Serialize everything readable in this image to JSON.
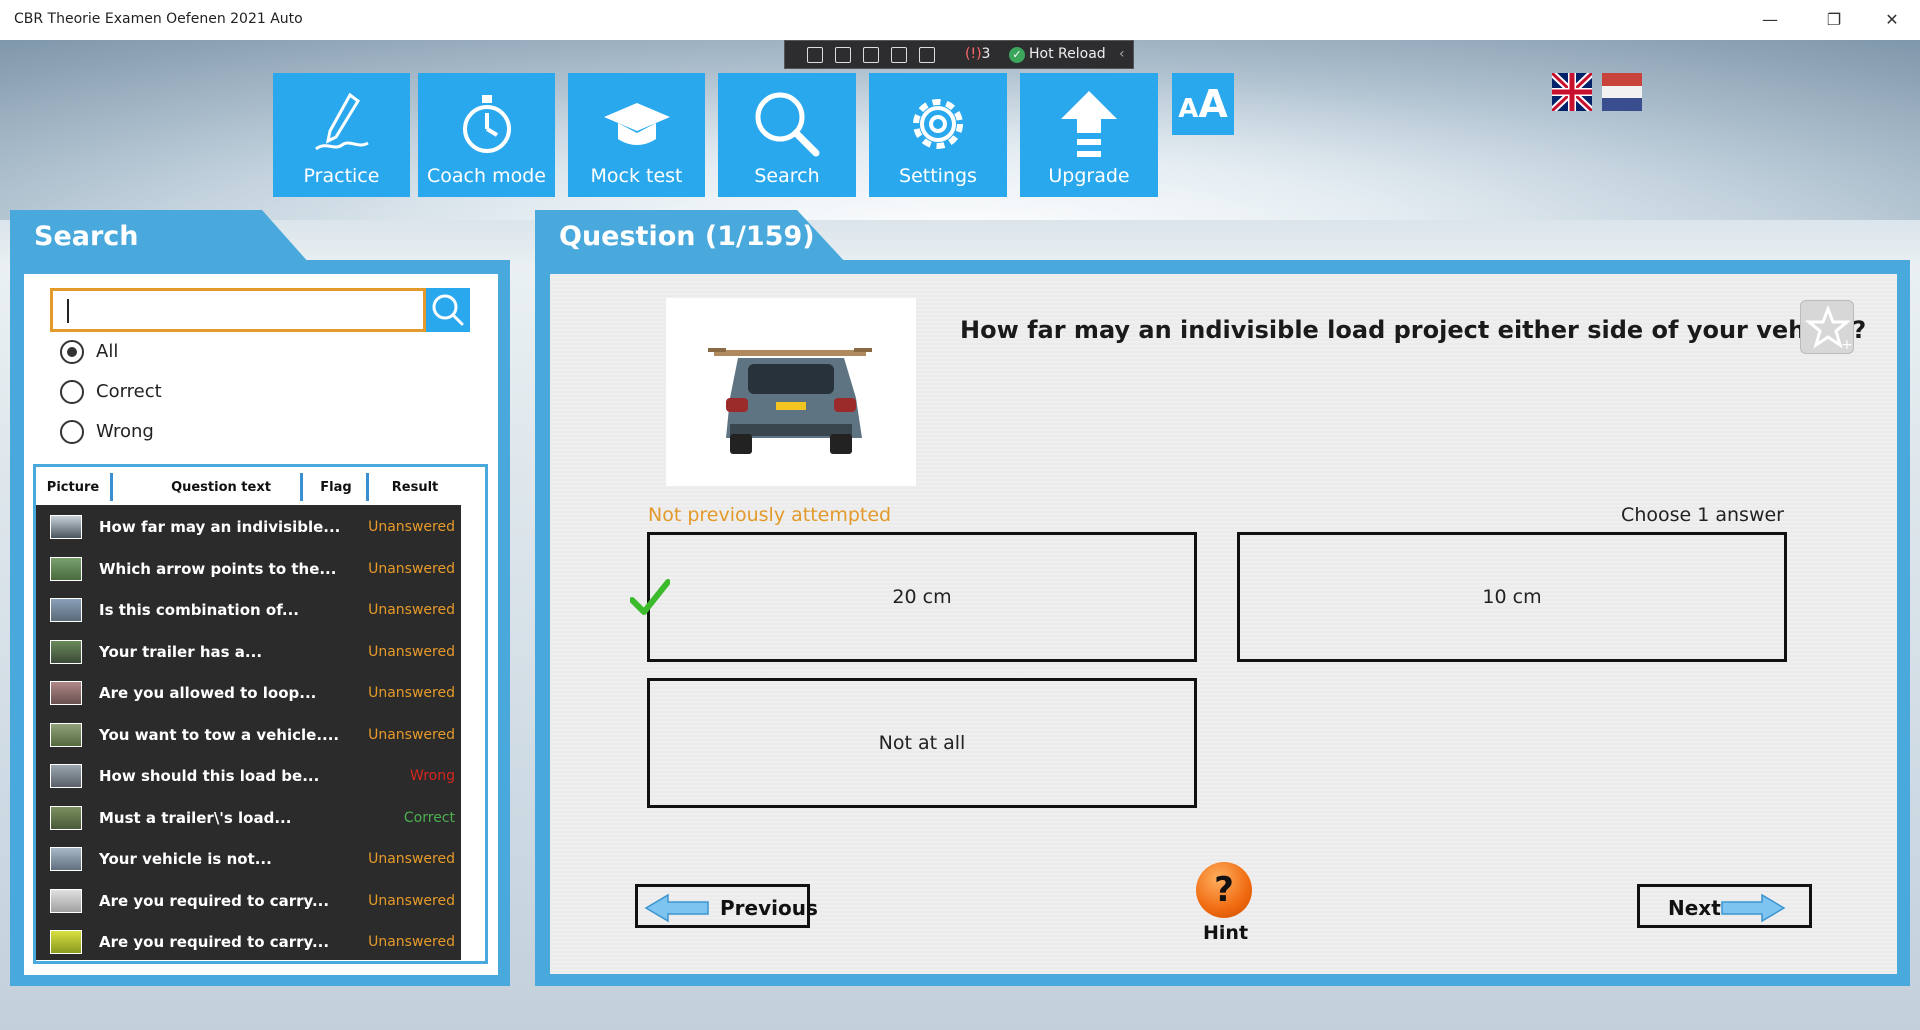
{
  "window": {
    "title": "CBR Theorie Examen Oefenen 2021 Auto",
    "minimize": "—",
    "maximize": "❐",
    "close": "✕"
  },
  "devtoolbar": {
    "badge_count": "3",
    "hot_reload": "Hot Reload"
  },
  "nav": {
    "practice": "Practice",
    "coach_mode": "Coach mode",
    "mock_test": "Mock test",
    "search": "Search",
    "settings": "Settings",
    "upgrade": "Upgrade",
    "font_size_small": "A",
    "font_size_large": "A"
  },
  "languages": [
    "english-flag",
    "dutch-flag"
  ],
  "search_panel": {
    "title": "Search",
    "input_value": "",
    "filters": [
      {
        "label": "All",
        "selected": true
      },
      {
        "label": "Correct",
        "selected": false
      },
      {
        "label": "Wrong",
        "selected": false
      }
    ],
    "columns": [
      "Picture",
      "Question text",
      "Flag",
      "Result"
    ],
    "rows": [
      {
        "text": "How far may an indivisible...",
        "result": "Unanswered",
        "status": "unanswered"
      },
      {
        "text": "Which arrow points to the...",
        "result": "Unanswered",
        "status": "unanswered"
      },
      {
        "text": "Is this combination of...",
        "result": "Unanswered",
        "status": "unanswered"
      },
      {
        "text": "Your trailer has a...",
        "result": "Unanswered",
        "status": "unanswered"
      },
      {
        "text": "Are you allowed to loop...",
        "result": "Unanswered",
        "status": "unanswered"
      },
      {
        "text": "You want to tow a vehicle....",
        "result": "Unanswered",
        "status": "unanswered"
      },
      {
        "text": "How should this load be...",
        "result": "Wrong",
        "status": "wrong"
      },
      {
        "text": "Must a trailer\\'s load...",
        "result": "Correct",
        "status": "correct"
      },
      {
        "text": "Your vehicle is not...",
        "result": "Unanswered",
        "status": "unanswered"
      },
      {
        "text": "Are you required to carry...",
        "result": "Unanswered",
        "status": "unanswered"
      },
      {
        "text": "Are you required to carry...",
        "result": "Unanswered",
        "status": "unanswered"
      }
    ]
  },
  "question_panel": {
    "title": "Question (1/159)",
    "question": "How far may an indivisible load project either side of your vehicle?",
    "attempt_status": "Not previously attempted",
    "instruction": "Choose 1 answer",
    "answers": [
      "20 cm",
      "10 cm",
      "Not at all"
    ],
    "correct_answer_index": 0,
    "previous": "Previous",
    "next": "Next",
    "hint": "Hint",
    "hint_symbol": "?"
  },
  "colors": {
    "tile_blue": "#2aa8ee",
    "panel_blue": "#4aa9dc",
    "accent_orange": "#e39a2b",
    "wrong_red": "#d7261d",
    "correct_green": "#4caf50"
  }
}
